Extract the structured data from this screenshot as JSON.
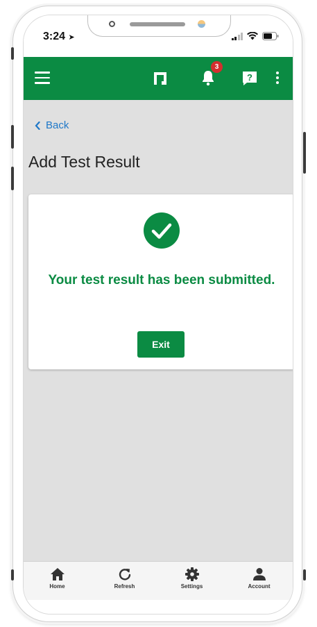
{
  "status_bar": {
    "time": "3:24"
  },
  "app_bar": {
    "notification_count": "3",
    "icons": [
      "menu-icon",
      "app-logo-icon",
      "bell-icon",
      "help-icon",
      "more-vert-icon"
    ]
  },
  "content": {
    "back_label": "Back",
    "page_title": "Add Test Result",
    "success_message": "Your test result has been submitted.",
    "exit_label": "Exit"
  },
  "bottom_nav": {
    "items": [
      {
        "label": "Home",
        "icon": "home-icon"
      },
      {
        "label": "Refresh",
        "icon": "refresh-icon"
      },
      {
        "label": "Settings",
        "icon": "gear-icon"
      },
      {
        "label": "Account",
        "icon": "person-icon"
      }
    ]
  },
  "colors": {
    "brand_green": "#0b8b43",
    "link_blue": "#1f78c8",
    "badge_red": "#d32f2f",
    "background_gray": "#e0e0e0"
  }
}
